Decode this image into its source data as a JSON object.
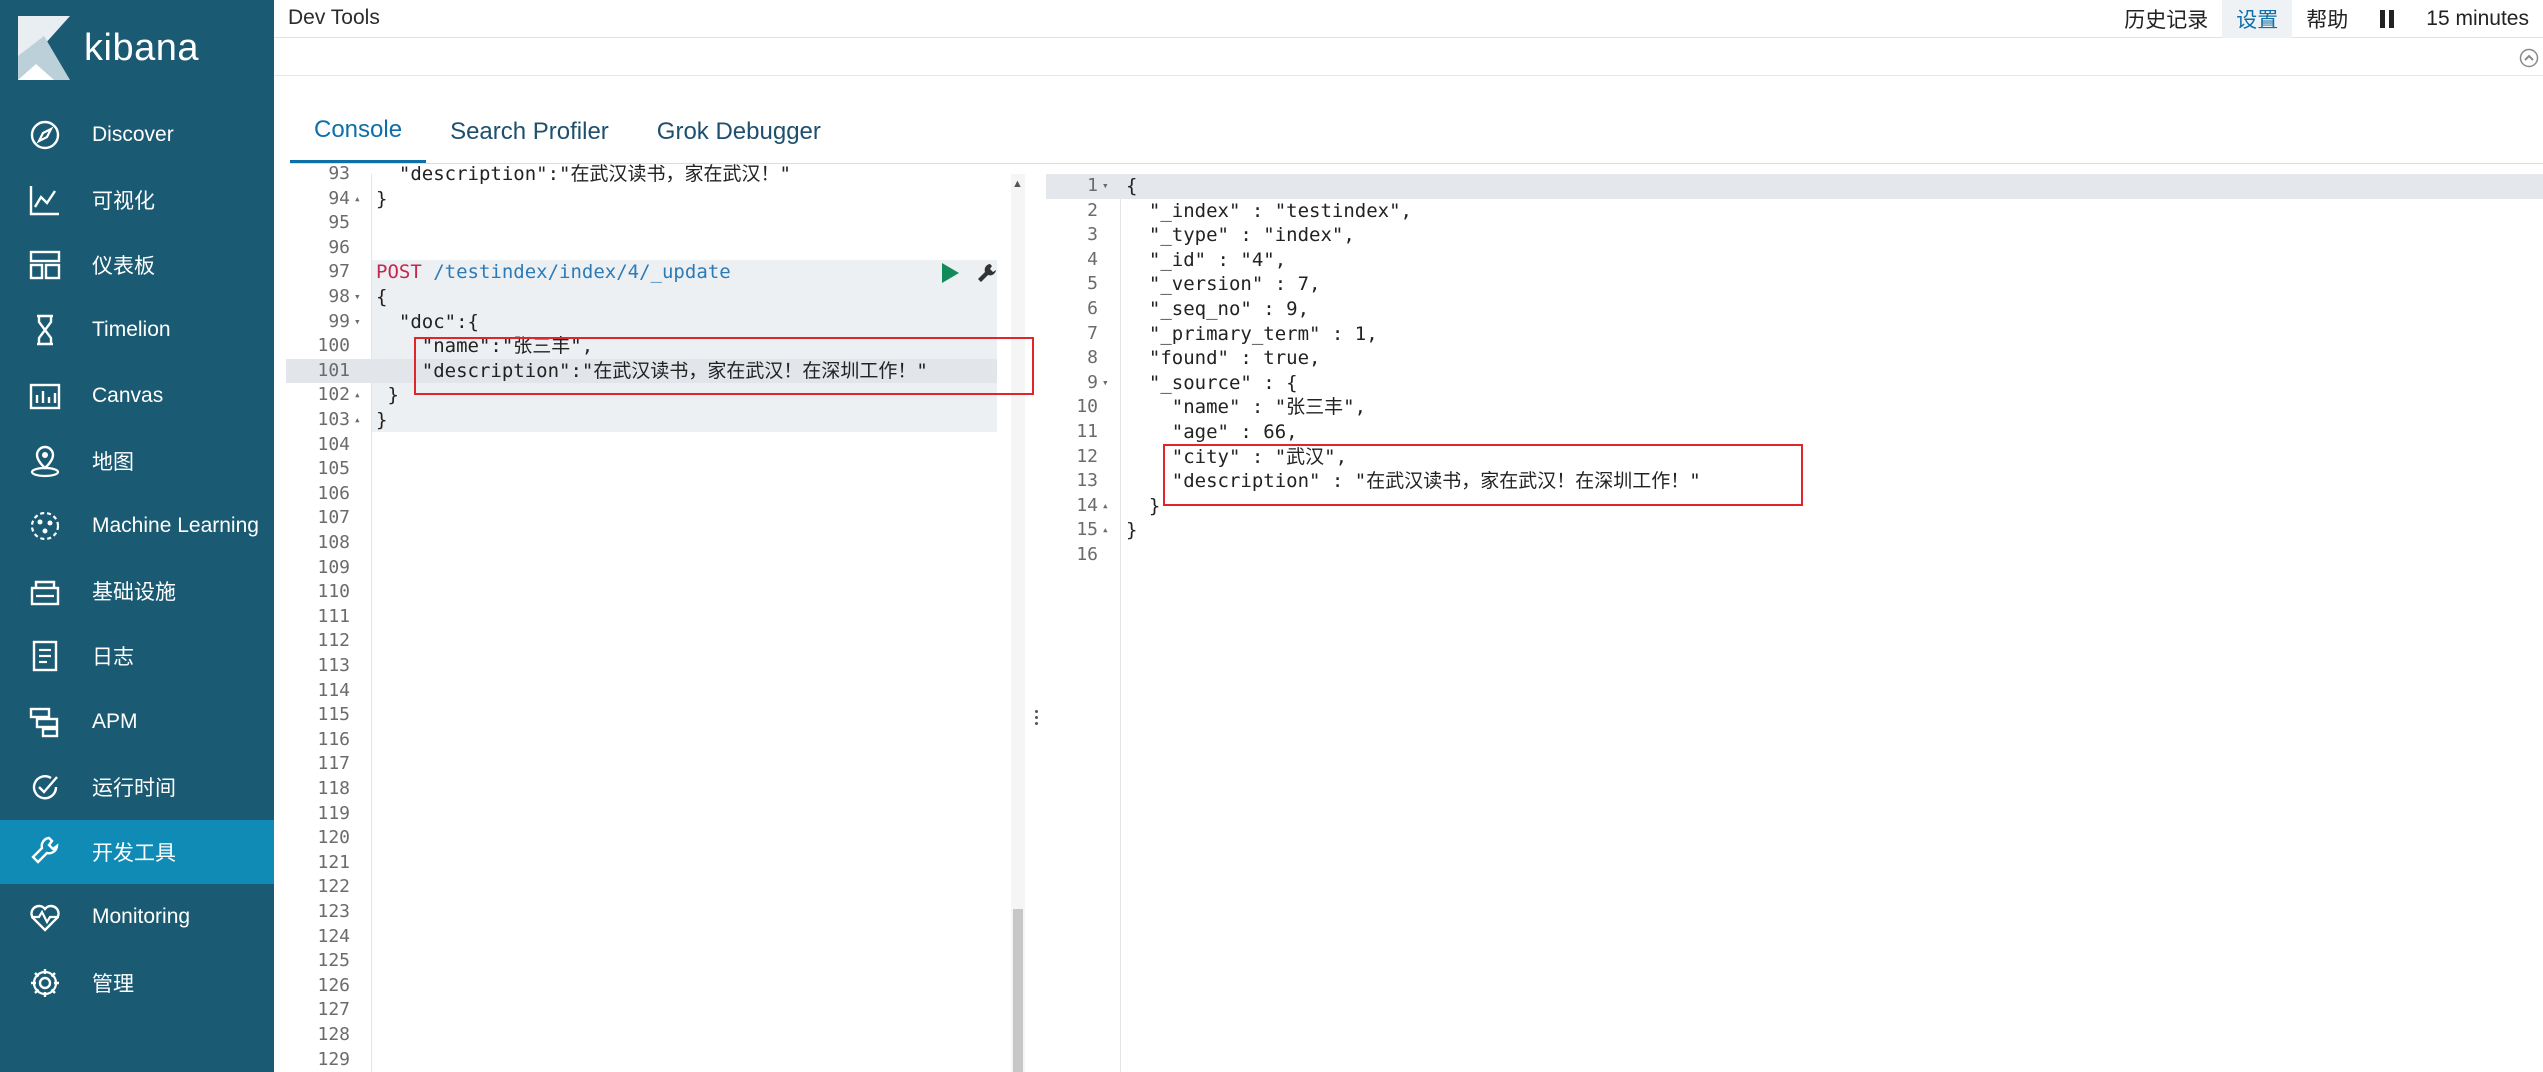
{
  "brand": {
    "name": "kibana"
  },
  "nav": [
    {
      "label": "Discover",
      "icon": "compass-icon"
    },
    {
      "label": "可视化",
      "icon": "visualize-icon"
    },
    {
      "label": "仪表板",
      "icon": "dashboard-icon"
    },
    {
      "label": "Timelion",
      "icon": "timelion-icon"
    },
    {
      "label": "Canvas",
      "icon": "canvas-icon"
    },
    {
      "label": "地图",
      "icon": "map-icon"
    },
    {
      "label": "Machine Learning",
      "icon": "machine-learning-icon"
    },
    {
      "label": "基础设施",
      "icon": "infrastructure-icon"
    },
    {
      "label": "日志",
      "icon": "logs-icon"
    },
    {
      "label": "APM",
      "icon": "apm-icon"
    },
    {
      "label": "运行时间",
      "icon": "uptime-icon"
    },
    {
      "label": "开发工具",
      "icon": "wrench-icon",
      "active": true
    },
    {
      "label": "Monitoring",
      "icon": "monitoring-icon"
    },
    {
      "label": "管理",
      "icon": "gear-icon"
    }
  ],
  "header": {
    "title": "Dev Tools",
    "history": "历史记录",
    "settings": "设置",
    "help": "帮助",
    "time": "15 minutes"
  },
  "tabs": [
    "Console",
    "Search Profiler",
    "Grok Debugger"
  ],
  "left_editor": {
    "lines": [
      {
        "n": "93",
        "text": "  \"description\":\"在武汉读书，家在武汉！\""
      },
      {
        "n": "94",
        "fold": "▴",
        "text": "}"
      },
      {
        "n": "95",
        "text": ""
      },
      {
        "n": "96",
        "text": ""
      },
      {
        "n": "97",
        "method": "POST",
        "path": "/testindex/index/4/_update"
      },
      {
        "n": "98",
        "fold": "▾",
        "text": "{"
      },
      {
        "n": "99",
        "fold": "▾",
        "text": "  \"doc\":{"
      },
      {
        "n": "100",
        "text": "    \"name\":\"张三丰\","
      },
      {
        "n": "101",
        "text": "    \"description\":\"在武汉读书，家在武汉！在深圳工作！\""
      },
      {
        "n": "102",
        "fold": "▴",
        "text": " }"
      },
      {
        "n": "103",
        "fold": "▴",
        "text": "}"
      },
      {
        "n": "104"
      },
      {
        "n": "105"
      },
      {
        "n": "106"
      },
      {
        "n": "107"
      },
      {
        "n": "108"
      },
      {
        "n": "109"
      },
      {
        "n": "110"
      },
      {
        "n": "111"
      },
      {
        "n": "112"
      },
      {
        "n": "113"
      },
      {
        "n": "114"
      },
      {
        "n": "115"
      },
      {
        "n": "116"
      },
      {
        "n": "117"
      },
      {
        "n": "118"
      },
      {
        "n": "119"
      },
      {
        "n": "120"
      },
      {
        "n": "121"
      },
      {
        "n": "122"
      },
      {
        "n": "123"
      },
      {
        "n": "124"
      },
      {
        "n": "125"
      },
      {
        "n": "126"
      },
      {
        "n": "127"
      },
      {
        "n": "128"
      },
      {
        "n": "129"
      }
    ]
  },
  "right_editor": {
    "lines": [
      {
        "n": "1",
        "fold": "▾",
        "text": "{"
      },
      {
        "n": "2",
        "text": "  \"_index\" : \"testindex\","
      },
      {
        "n": "3",
        "text": "  \"_type\" : \"index\","
      },
      {
        "n": "4",
        "text": "  \"_id\" : \"4\","
      },
      {
        "n": "5",
        "text": "  \"_version\" : 7,"
      },
      {
        "n": "6",
        "text": "  \"_seq_no\" : 9,"
      },
      {
        "n": "7",
        "text": "  \"_primary_term\" : 1,"
      },
      {
        "n": "8",
        "text": "  \"found\" : true,"
      },
      {
        "n": "9",
        "fold": "▾",
        "text": "  \"_source\" : {"
      },
      {
        "n": "10",
        "text": "    \"name\" : \"张三丰\","
      },
      {
        "n": "11",
        "text": "    \"age\" : 66,"
      },
      {
        "n": "12",
        "text": "    \"city\" : \"武汉\","
      },
      {
        "n": "13",
        "text": "    \"description\" : \"在武汉读书，家在武汉！在深圳工作！\""
      },
      {
        "n": "14",
        "fold": "▴",
        "text": "  }"
      },
      {
        "n": "15",
        "fold": "▴",
        "text": "}"
      },
      {
        "n": "16",
        "text": ""
      }
    ]
  }
}
